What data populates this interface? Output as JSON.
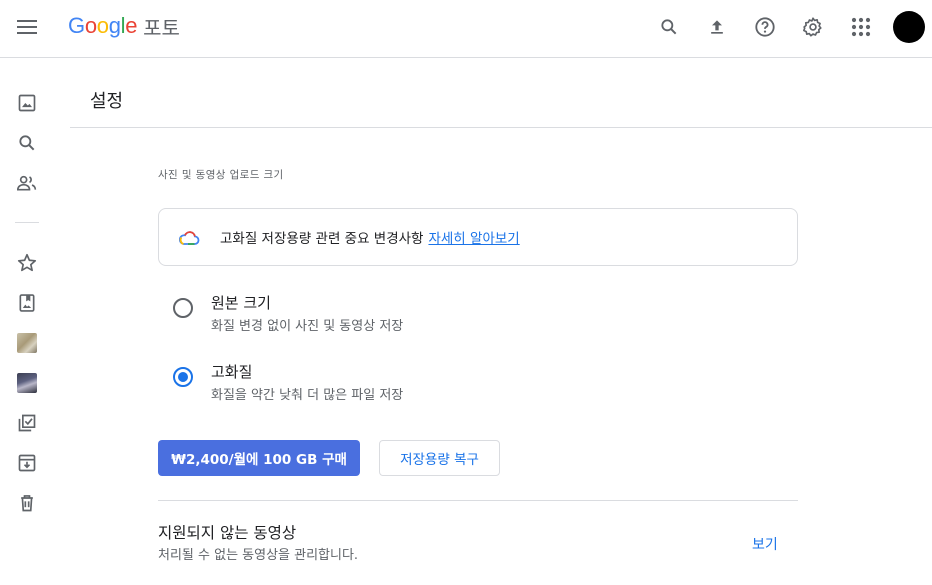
{
  "header": {
    "logo_letters": [
      {
        "ch": "G",
        "color": "#4285F4"
      },
      {
        "ch": "o",
        "color": "#EA4335"
      },
      {
        "ch": "o",
        "color": "#FBBC05"
      },
      {
        "ch": "g",
        "color": "#4285F4"
      },
      {
        "ch": "l",
        "color": "#34A853"
      },
      {
        "ch": "e",
        "color": "#EA4335"
      }
    ],
    "product_name": "포토",
    "icons": [
      "menu-icon",
      "search-icon",
      "upload-icon",
      "help-icon",
      "settings-icon",
      "apps-icon",
      "avatar"
    ]
  },
  "sidebar": {
    "items": [
      "photos-icon",
      "search-icon",
      "sharing-icon",
      "favorites-icon",
      "album-icon",
      "album-thumb-1",
      "album-thumb-2",
      "utilities-icon",
      "archive-icon",
      "trash-icon"
    ]
  },
  "page": {
    "title": "설정"
  },
  "upload_size": {
    "section_label": "사진 및 동영상 업로드 크기",
    "notice_text": "고화질 저장용량 관련 중요 변경사항",
    "notice_link": "자세히 알아보기",
    "options": [
      {
        "title": "원본 크기",
        "desc": "화질 변경 없이 사진 및 동영상 저장",
        "selected": false
      },
      {
        "title": "고화질",
        "desc": "화질을 약간 낮춰 더 많은 파일 저장",
        "selected": true
      }
    ],
    "buy_button": "₩2,400/월에 100 GB 구매",
    "restore_button": "저장용량 복구"
  },
  "unsupported_videos": {
    "title": "지원되지 않는 동영상",
    "desc": "처리될 수 없는 동영상을 관리합니다.",
    "link": "보기"
  },
  "colors": {
    "accent": "#1a73e8",
    "buy_button_bg": "#4a6fdf",
    "divider": "#dadce0"
  }
}
